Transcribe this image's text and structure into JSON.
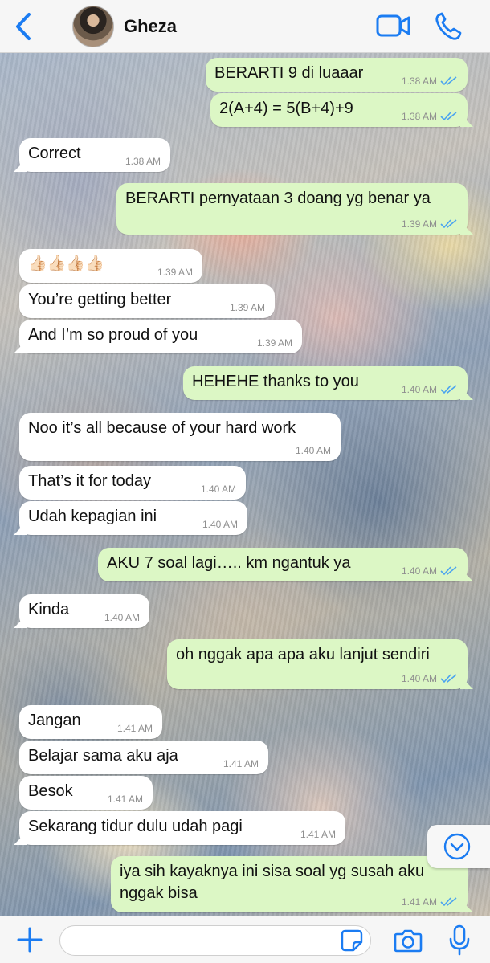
{
  "header": {
    "contact_name": "Gheza",
    "back_icon": "chevron-left-icon",
    "video_icon": "video-camera-icon",
    "call_icon": "phone-icon",
    "accent_color": "#1b7cf2"
  },
  "messages": [
    {
      "dir": "out",
      "text": "BERARTI 9 di luaaar",
      "time": "1.38 AM"
    },
    {
      "dir": "out",
      "text": "2(A+4) = 5(B+4)+9",
      "time": "1.38 AM"
    },
    {
      "dir": "in",
      "text": "Correct",
      "time": "1.38 AM"
    },
    {
      "dir": "out",
      "text": "BERARTI pernyataan 3 doang yg benar ya",
      "time": "1.39 AM"
    },
    {
      "dir": "in",
      "text": "👍🏻👍🏻👍🏻👍🏻",
      "time": "1.39 AM"
    },
    {
      "dir": "in",
      "text": "You’re getting better",
      "time": "1.39 AM"
    },
    {
      "dir": "in",
      "text": "And I’m so proud of you",
      "time": "1.39 AM"
    },
    {
      "dir": "out",
      "text": "HEHEHE thanks to you",
      "time": "1.40 AM"
    },
    {
      "dir": "in",
      "text": "Noo it’s all because of your hard work",
      "time": "1.40 AM"
    },
    {
      "dir": "in",
      "text": "That’s it for today",
      "time": "1.40 AM"
    },
    {
      "dir": "in",
      "text": "Udah kepagian ini",
      "time": "1.40 AM"
    },
    {
      "dir": "out",
      "text": "AKU 7 soal lagi….. km ngantuk ya",
      "time": "1.40 AM"
    },
    {
      "dir": "in",
      "text": "Kinda",
      "time": "1.40 AM"
    },
    {
      "dir": "out",
      "text": "oh nggak apa apa aku lanjut sendiri",
      "time": "1.40 AM"
    },
    {
      "dir": "in",
      "text": "Jangan",
      "time": "1.41 AM"
    },
    {
      "dir": "in",
      "text": "Belajar sama aku aja",
      "time": "1.41 AM"
    },
    {
      "dir": "in",
      "text": "Besok",
      "time": "1.41 AM"
    },
    {
      "dir": "in",
      "text": "Sekarang tidur dulu udah pagi",
      "time": "1.41 AM"
    },
    {
      "dir": "out",
      "text": "iya sih kayaknya ini sisa soal yg susah aku nggak bisa",
      "time": "1.41 AM"
    }
  ],
  "input": {
    "placeholder": "",
    "plus_icon": "plus-icon",
    "sticker_icon": "sticker-icon",
    "camera_icon": "camera-icon",
    "mic_icon": "microphone-icon"
  },
  "scroll_button_icon": "chevron-down-circle-icon",
  "colors": {
    "incoming_bubble": "#ffffff",
    "outgoing_bubble": "#dcf7c5",
    "read_tick": "#4aa3f0"
  }
}
